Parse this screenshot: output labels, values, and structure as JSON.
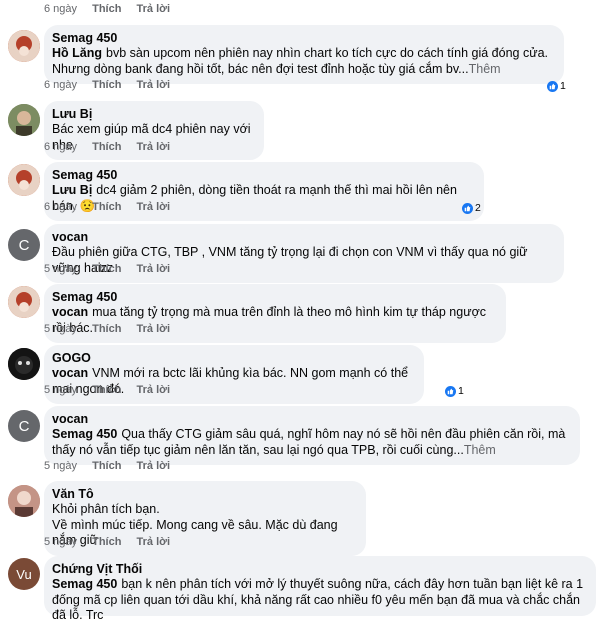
{
  "top_actions": {
    "time": "6 ngày",
    "like": "Thích",
    "reply": "Trả lời"
  },
  "comments": [
    {
      "author": "Semag 450",
      "mention": "Hồ Lăng",
      "text": "bvb sàn upcom nên phiên nay nhìn chart ko tích cực do cách tính giá đóng cửa. Nhưng dòng bank đang hồi tốt, bác nên đợi test đỉnh hoặc tùy giá cắm bv...",
      "more": "Thêm",
      "time": "6 ngày",
      "like": "Thích",
      "reply": "Trả lời",
      "reactions": "1"
    },
    {
      "author": "Lưu Bị",
      "mention": "",
      "text": "Bác xem giúp mã dc4 phiên nay với nhe",
      "time": "6 ngày",
      "like": "Thích",
      "reply": "Trả lời"
    },
    {
      "author": "Semag 450",
      "mention": "Lưu Bị",
      "text": "dc4 giảm 2 phiên, dòng tiền thoát ra mạnh thế thì mai hồi lên nên bán. 😟",
      "time": "6 ngày",
      "like": "Thích",
      "reply": "Trả lời",
      "reactions": "2"
    },
    {
      "author": "vocan",
      "avatar_letter": "C",
      "mention": "",
      "text": "Đầu phiên giữa CTG, TBP , VNM  tăng tỷ trọng lại đi chọn con VNM vì thấy qua nó giữ vững haizz",
      "time": "5 ngày",
      "like": "Thích",
      "reply": "Trả lời"
    },
    {
      "author": "Semag 450",
      "mention": "vocan",
      "text": "mua tăng tỷ trọng mà mua trên đỉnh là theo mô hình kim tự tháp ngược rồi bác.",
      "time": "5 ngày",
      "like": "Thích",
      "reply": "Trả lời"
    },
    {
      "author": "GOGO",
      "mention": "vocan",
      "text": "VNM mới ra bctc lãi khủng kìa bác. NN gom mạnh có thể mai ngon đó.",
      "time": "5 ngày",
      "like": "Thích",
      "reply": "Trả lời",
      "reactions": "1"
    },
    {
      "author": "vocan",
      "avatar_letter": "C",
      "mention": "Semag 450",
      "text": "Qua thấy CTG giảm sâu quá, nghĩ hôm nay nó sẽ hồi nên đầu phiên căn rồi, mà thấy nó vẫn tiếp tục giảm nên lăn tăn, sau lại ngó qua TPB, rồi cuối cùng...",
      "more": "Thêm",
      "time": "5 ngày",
      "like": "Thích",
      "reply": "Trả lời"
    },
    {
      "author": "Văn Tô",
      "mention": "",
      "text_lines": [
        "Khỏi phân tích bạn.",
        "Về mình múc tiếp. Mong cang về sâu. Mặc dù đang nắm giữ"
      ],
      "time": "5 ngày",
      "like": "Thích",
      "reply": "Trả lời"
    },
    {
      "author": "Chứng Vịt Thối",
      "avatar_letter": "Vu",
      "mention": "Semag 450",
      "text": "bạn k nên phân tích với mở lý thuyết suông nữa, cách đây hơn tuần bạn liệt kê ra 1 đống mã cp liên quan tới dầu khí, khả năng rất cao nhiều f0 yêu mến bạn đã mua và chắc chắn đã lỗ. Trc"
    }
  ]
}
